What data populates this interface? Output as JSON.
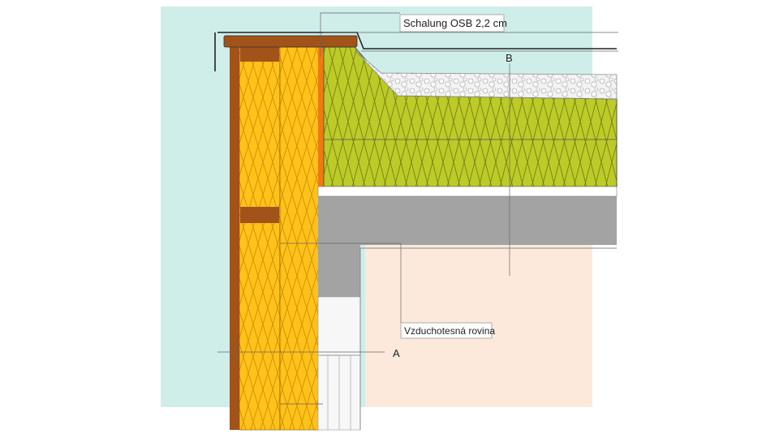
{
  "labels": {
    "sheathing": "Schalung OSB 2,2 cm",
    "airtight_plane": "Vzduchotesná rovina",
    "marker_a": "A",
    "marker_b": "B"
  },
  "colors": {
    "exterior": "#cfeeea",
    "interior": "#fde9dc",
    "wood_insulation": "#ffc21a",
    "mineral_wool": "#bccb28",
    "timber": "#a2531a",
    "osb": "#f07a10",
    "concrete": "#a3a3a3",
    "gravel": "#f3f3f3"
  }
}
